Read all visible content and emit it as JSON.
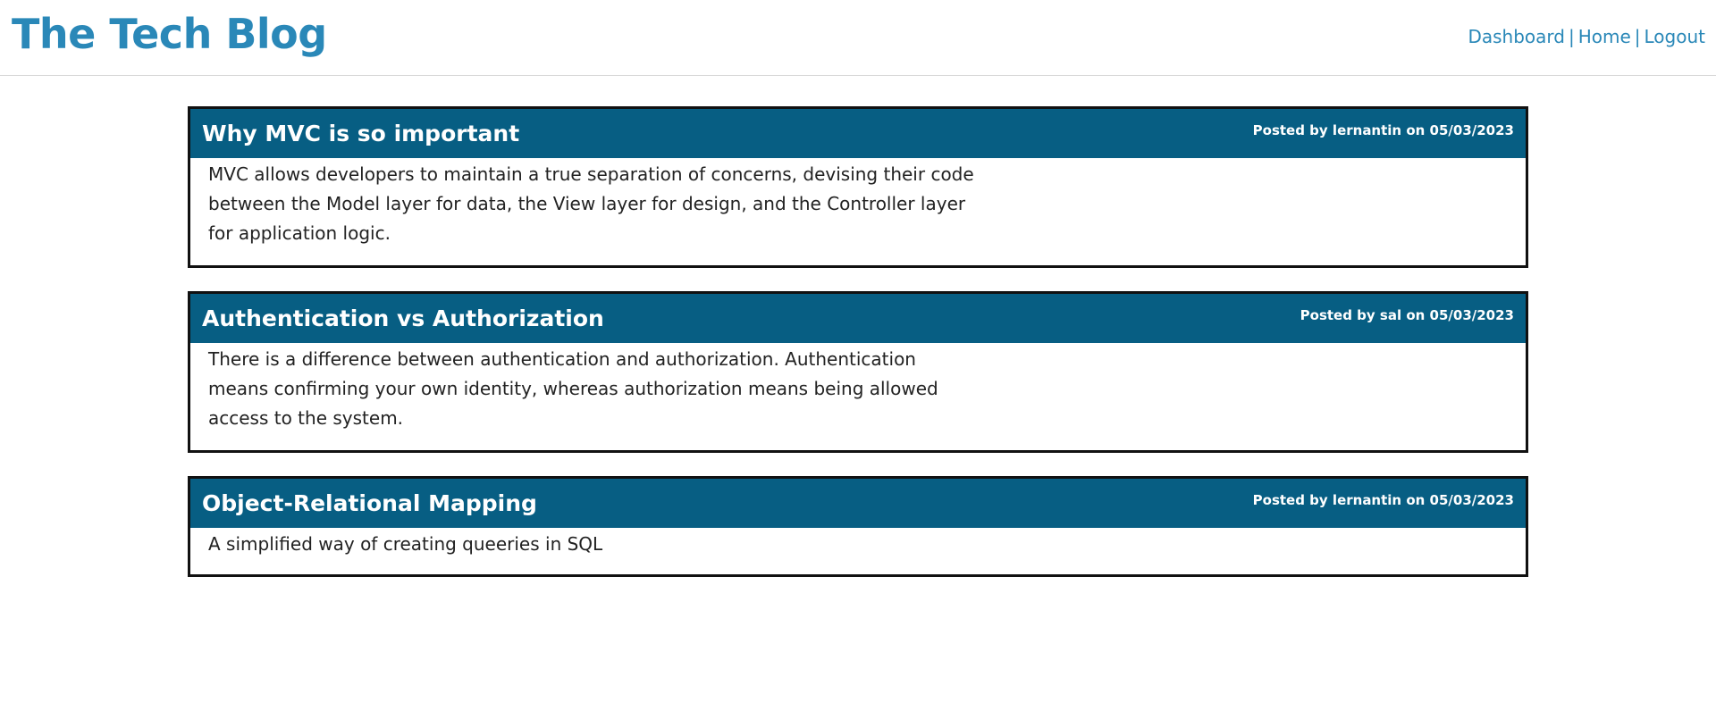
{
  "header": {
    "title": "The Tech Blog",
    "nav": [
      {
        "label": "Dashboard"
      },
      {
        "label": "Home"
      },
      {
        "label": "Logout"
      }
    ],
    "separator": "|"
  },
  "posts": [
    {
      "title": "Why MVC is so important",
      "meta": "Posted by lernantin on 05/03/2023",
      "body": "MVC allows developers to maintain a true separation of concerns, devising their code between the Model layer for data, the View layer for design, and the Controller layer for application logic."
    },
    {
      "title": "Authentication vs Authorization",
      "meta": "Posted by sal on 05/03/2023",
      "body": "There is a difference between authentication and authorization. Authentication means confirming your own identity, whereas authorization means being allowed access to the system."
    },
    {
      "title": "Object-Relational Mapping",
      "meta": "Posted by lernantin on 05/03/2023",
      "body": "A simplified way of creating queeries in SQL"
    }
  ],
  "colors": {
    "brand": "#2a88b8",
    "post_header": "#075e83",
    "post_border": "#111111"
  }
}
